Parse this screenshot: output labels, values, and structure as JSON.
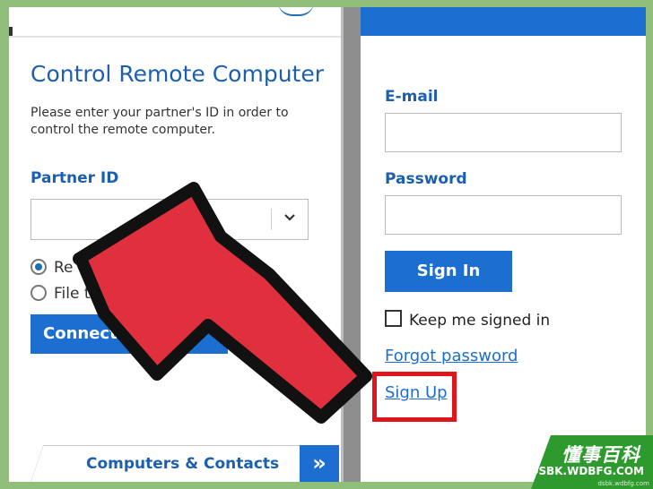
{
  "left_panel": {
    "title": "Control Remote Computer",
    "description": "Please enter your partner's ID in order to control the remote computer.",
    "partner_label": "Partner ID",
    "partner_value": "",
    "radio_remote": "Re",
    "radio_file": "File tra",
    "connect_label": "Connect to",
    "computers_contacts_label": "Computers & Contacts",
    "expand_icon": "»"
  },
  "right_panel": {
    "email_label": "E-mail",
    "email_value": "",
    "password_label": "Password",
    "password_value": "",
    "signin_label": "Sign In",
    "keep_signed_label": "Keep me signed in",
    "forgot_link": "Forgot password",
    "signup_link": "Sign Up"
  },
  "watermark": {
    "name": "懂事百科",
    "url": "DSBK.WDBFG.COM",
    "small": "dsbk.wdbfg.com"
  },
  "colors": {
    "accent": "#1c6fd0",
    "arrow_fill": "#e0303e",
    "highlight": "#e0161d",
    "background": "#8fbf7a"
  },
  "icons": [
    "chevron-down-icon",
    "double-chevron-right-icon",
    "pointer-arrow-icon"
  ]
}
